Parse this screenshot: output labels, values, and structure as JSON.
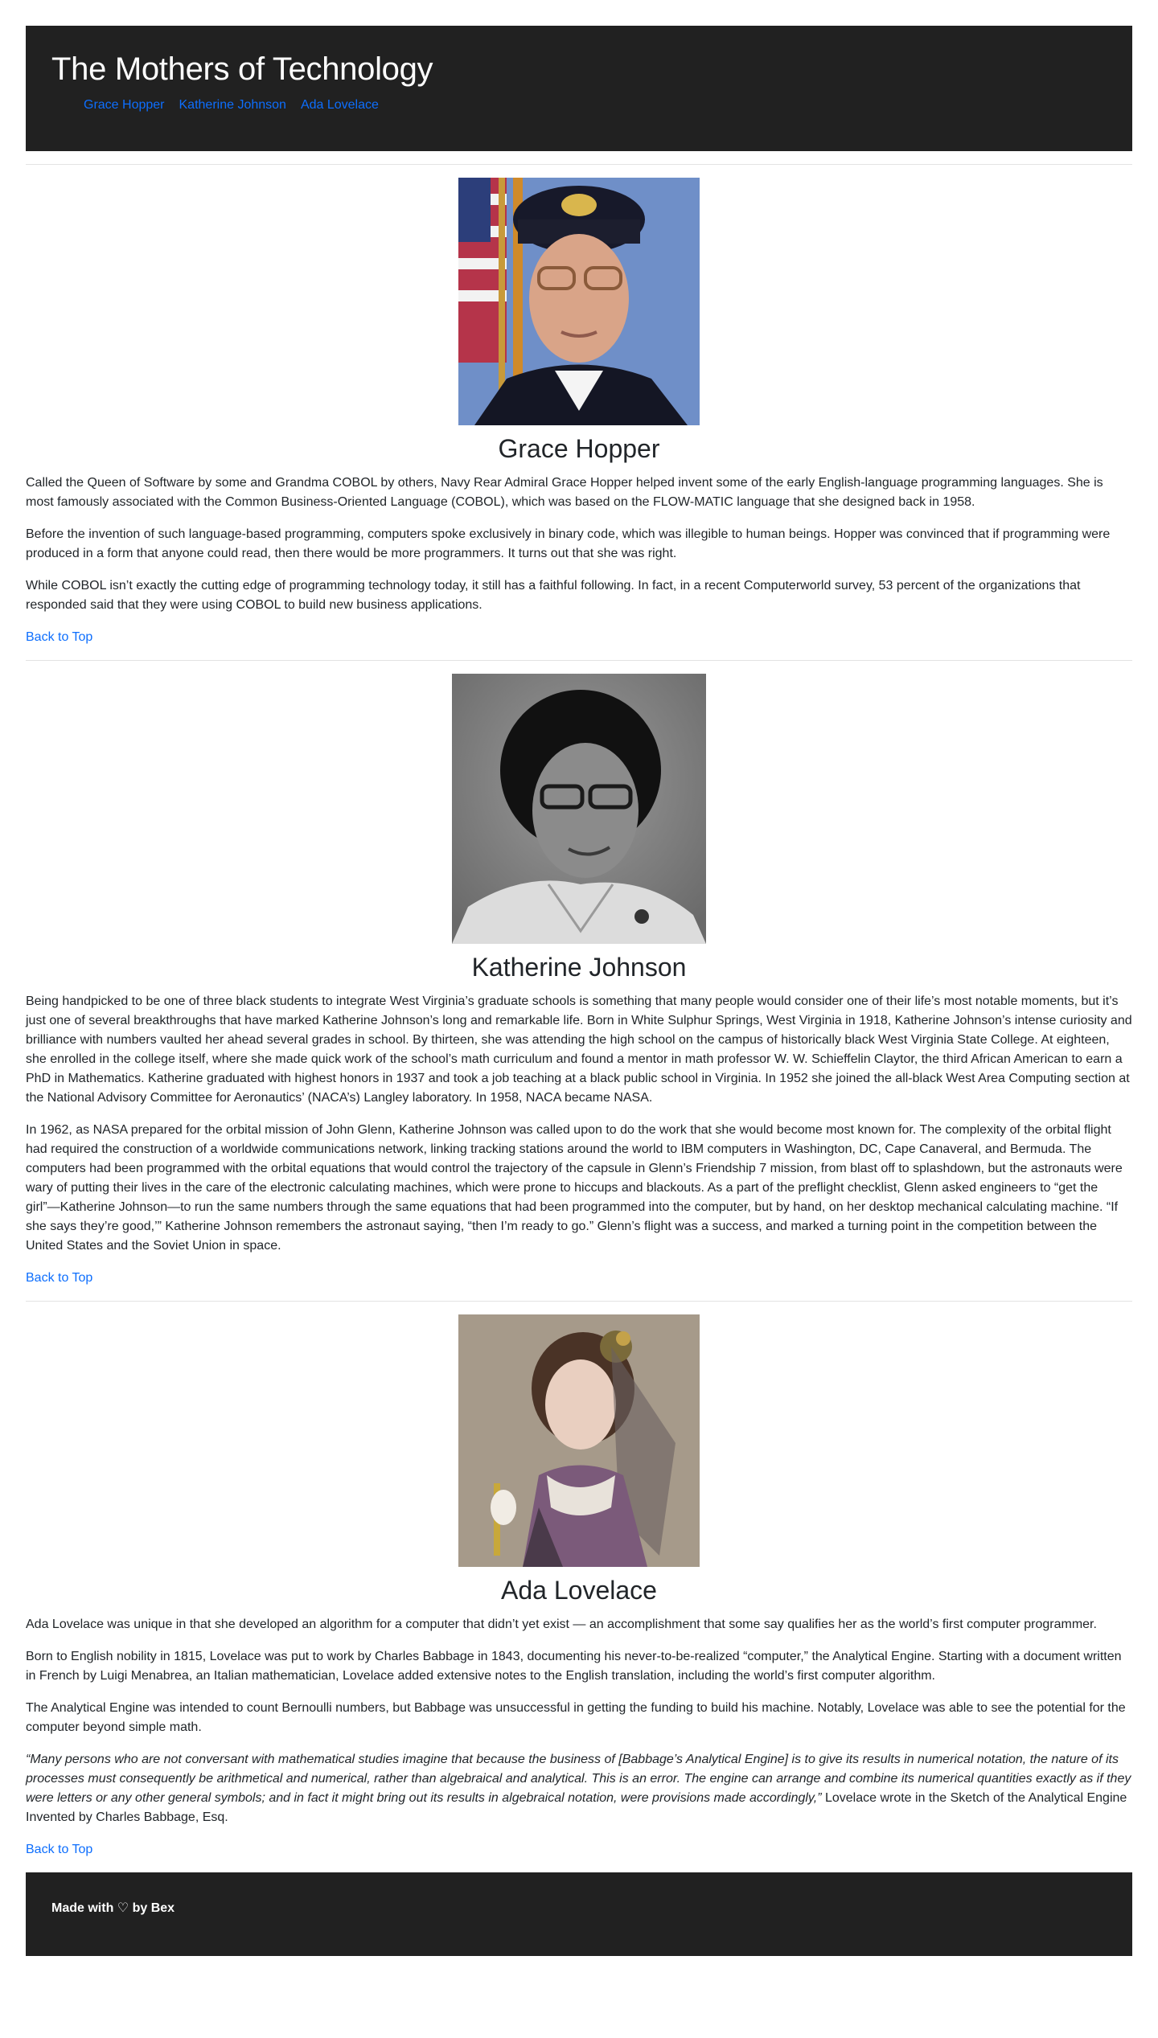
{
  "header": {
    "title": "The Mothers of Technology",
    "nav": [
      {
        "label": "Grace Hopper"
      },
      {
        "label": "Katherine Johnson"
      },
      {
        "label": "Ada Lovelace"
      }
    ]
  },
  "bios": [
    {
      "name": "Grace Hopper",
      "photo_alt": "Grace Hopper",
      "paragraphs": [
        "Called the Queen of Software by some and Grandma COBOL by others, Navy Rear Admiral Grace Hopper helped invent some of the early English-language programming languages. She is most famously associated with the Common Business-Oriented Language (COBOL), which was based on the FLOW-MATIC language that she designed back in 1958.",
        "Before the invention of such language-based programming, computers spoke exclusively in binary code, which was illegible to human beings. Hopper was convinced that if programming were produced in a form that anyone could read, then there would be more programmers. It turns out that she was right.",
        "While COBOL isn’t exactly the cutting edge of programming technology today, it still has a faithful following. In fact, in a recent Computerworld survey, 53 percent of the organizations that responded said that they were using COBOL to build new business applications."
      ],
      "back_label": "Back to Top"
    },
    {
      "name": "Katherine Johnson",
      "photo_alt": "Katherine Johnson",
      "paragraphs": [
        "Being handpicked to be one of three black students to integrate West Virginia’s graduate schools is something that many people would consider one of their life’s most notable moments, but it’s just one of several breakthroughs that have marked Katherine Johnson’s long and remarkable life. Born in White Sulphur Springs, West Virginia in 1918, Katherine Johnson’s intense curiosity and brilliance with numbers vaulted her ahead several grades in school. By thirteen, she was attending the high school on the campus of historically black West Virginia State College. At eighteen, she enrolled in the college itself, where she made quick work of the school’s math curriculum and found a mentor in math professor W. W. Schieffelin Claytor, the third African American to earn a PhD in Mathematics. Katherine graduated with highest honors in 1937 and took a job teaching at a black public school in Virginia. In 1952 she joined the all-black West Area Computing section at the National Advisory Committee for Aeronautics’ (NACA’s) Langley laboratory. In 1958, NACA became NASA.",
        "In 1962, as NASA prepared for the orbital mission of John Glenn, Katherine Johnson was called upon to do the work that she would become most known for. The complexity of the orbital flight had required the construction of a worldwide communications network, linking tracking stations around the world to IBM computers in Washington, DC, Cape Canaveral, and Bermuda. The computers had been programmed with the orbital equations that would control the trajectory of the capsule in Glenn’s Friendship 7 mission, from blast off to splashdown, but the astronauts were wary of putting their lives in the care of the electronic calculating machines, which were prone to hiccups and blackouts. As a part of the preflight checklist, Glenn asked engineers to “get the girl”—Katherine Johnson—to run the same numbers through the same equations that had been programmed into the computer, but by hand, on her desktop mechanical calculating machine. “If she says they’re good,’” Katherine Johnson remembers the astronaut saying, “then I’m ready to go.” Glenn’s flight was a success, and marked a turning point in the competition between the United States and the Soviet Union in space."
      ],
      "back_label": "Back to Top"
    },
    {
      "name": "Ada Lovelace",
      "photo_alt": "Ada Lovelace",
      "paragraphs": [
        "Ada Lovelace was unique in that she developed an algorithm for a computer that didn’t yet exist — an accomplishment that some say qualifies her as the world’s first computer programmer.",
        "Born to English nobility in 1815, Lovelace was put to work by Charles Babbage in 1843, documenting his never-to-be-realized “computer,” the Analytical Engine. Starting with a document written in French by Luigi Menabrea, an Italian mathematician, Lovelace added extensive notes to the English translation, including the world’s first computer algorithm.",
        "The Analytical Engine was intended to count Bernoulli numbers, but Babbage was unsuccessful in getting the funding to build his machine. Notably, Lovelace was able to see the potential for the computer beyond simple math."
      ],
      "quote": "“Many persons who are not conversant with mathematical studies imagine that because the business of [Babbage’s Analytical Engine] is to give its results in numerical notation, the nature of its processes must consequently be arithmetical and numerical, rather than algebraical and analytical. This is an error. The engine can arrange and combine its numerical quantities exactly as if they were letters or any other general symbols; and in fact it might bring out its results in algebraical notation, were provisions made accordingly,”",
      "quote_tail": " Lovelace wrote in the Sketch of the Analytical Engine Invented by Charles Babbage, Esq.",
      "back_label": "Back to Top"
    }
  ],
  "footer": {
    "text": "Made with ♡ by Bex"
  },
  "colors": {
    "header_bg": "#212121",
    "link": "#0d6efd",
    "text": "#212529"
  }
}
